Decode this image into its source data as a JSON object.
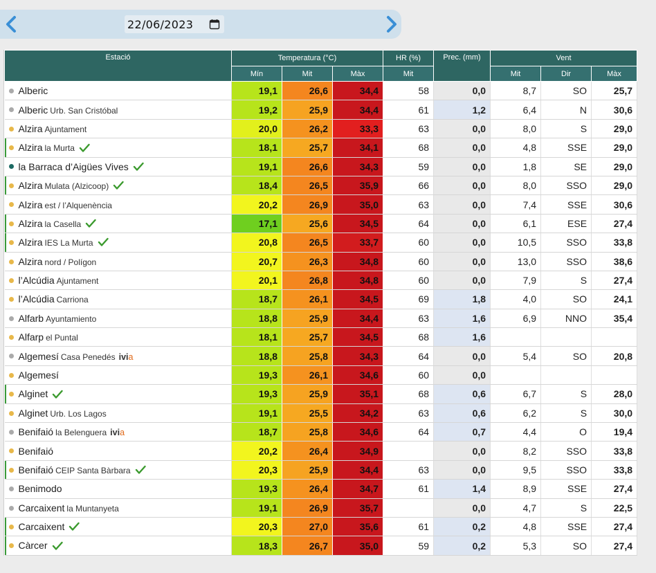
{
  "date": {
    "value": "22/06/2023",
    "prev_icon": "chevron-left-icon",
    "next_icon": "chevron-right-icon",
    "calendar_icon": "calendar-icon"
  },
  "colors": {
    "header_bg": "#2e6662",
    "nav_arrow": "#3a8fd6",
    "check": "#3b9a2e",
    "dot_yellow": "#e8b84a",
    "dot_gray": "#aaaaaa",
    "dot_teal": "#1c6a63"
  },
  "table": {
    "headers": {
      "station": "Estació",
      "temperature": "Temperatura (°C)",
      "humidity": "HR (%)",
      "precip": "Prec. (mm)",
      "wind": "Vent",
      "t_min": "Mín",
      "t_mid": "Mit",
      "t_max": "Màx",
      "hr_mid": "Mit",
      "w_mid": "Mit",
      "w_dir": "Dir",
      "w_max": "Màx"
    },
    "rows": [
      {
        "name": "Alberic",
        "sub": "",
        "dot": "gray",
        "check": false,
        "ivia": false,
        "flag": false,
        "tmin": "19,1",
        "tmid": "26,6",
        "tmax": "34,4",
        "tmin_c": "#b7e41b",
        "tmid_c": "#f4861f",
        "tmax_c": "#c8171d",
        "hr": "58",
        "prec": "0,0",
        "wet": false,
        "wmid": "8,7",
        "wdir": "SO",
        "wmax": "25,7"
      },
      {
        "name": "Alberic",
        "sub": "Urb. San Cristóbal",
        "dot": "gray",
        "check": false,
        "ivia": false,
        "flag": false,
        "tmin": "19,2",
        "tmid": "25,9",
        "tmax": "34,4",
        "tmin_c": "#b7e41b",
        "tmid_c": "#f6a321",
        "tmax_c": "#c8171d",
        "hr": "61",
        "prec": "1,2",
        "wet": true,
        "wmid": "6,4",
        "wdir": "N",
        "wmax": "30,6"
      },
      {
        "name": "Alzira",
        "sub": "Ajuntament",
        "dot": "yellow",
        "check": false,
        "ivia": false,
        "flag": false,
        "tmin": "20,0",
        "tmid": "26,2",
        "tmax": "33,3",
        "tmin_c": "#e2f01c",
        "tmid_c": "#f5921f",
        "tmax_c": "#e21f1f",
        "hr": "63",
        "prec": "0,0",
        "wet": false,
        "wmid": "8,0",
        "wdir": "S",
        "wmax": "29,0"
      },
      {
        "name": "Alzira",
        "sub": "la Murta",
        "dot": "yellow",
        "check": true,
        "ivia": false,
        "flag": true,
        "tmin": "18,1",
        "tmid": "25,7",
        "tmax": "34,1",
        "tmin_c": "#b7e41b",
        "tmid_c": "#f6a821",
        "tmax_c": "#c8171d",
        "hr": "68",
        "prec": "0,0",
        "wet": false,
        "wmid": "4,8",
        "wdir": "SSE",
        "wmax": "29,0"
      },
      {
        "name": "la Barraca d’Aigües Vives",
        "sub": "",
        "dot": "teal",
        "check": true,
        "ivia": false,
        "flag": false,
        "tmin": "19,1",
        "tmid": "26,6",
        "tmax": "34,3",
        "tmin_c": "#b7e41b",
        "tmid_c": "#f4861f",
        "tmax_c": "#c8171d",
        "hr": "59",
        "prec": "0,0",
        "wet": false,
        "wmid": "1,8",
        "wdir": "SE",
        "wmax": "29,0"
      },
      {
        "name": "Alzira",
        "sub": "Mulata (Alzicoop)",
        "dot": "yellow",
        "check": true,
        "ivia": false,
        "flag": true,
        "tmin": "18,4",
        "tmid": "26,5",
        "tmax": "35,9",
        "tmin_c": "#b7e41b",
        "tmid_c": "#f4861f",
        "tmax_c": "#c8171d",
        "hr": "66",
        "prec": "0,0",
        "wet": false,
        "wmid": "8,0",
        "wdir": "SSO",
        "wmax": "29,0"
      },
      {
        "name": "Alzira",
        "sub": "est / l’Alquenència",
        "dot": "yellow",
        "check": false,
        "ivia": false,
        "flag": false,
        "tmin": "20,2",
        "tmid": "26,9",
        "tmax": "35,0",
        "tmin_c": "#f2f51e",
        "tmid_c": "#f4861f",
        "tmax_c": "#c8171d",
        "hr": "63",
        "prec": "0,0",
        "wet": false,
        "wmid": "7,4",
        "wdir": "SSE",
        "wmax": "30,6"
      },
      {
        "name": "Alzira",
        "sub": "la Casella",
        "dot": "yellow",
        "check": true,
        "ivia": false,
        "flag": true,
        "tmin": "17,1",
        "tmid": "25,6",
        "tmax": "34,5",
        "tmin_c": "#6fcf1f",
        "tmid_c": "#f6a821",
        "tmax_c": "#c8171d",
        "hr": "64",
        "prec": "0,0",
        "wet": false,
        "wmid": "6,1",
        "wdir": "ESE",
        "wmax": "27,4"
      },
      {
        "name": "Alzira",
        "sub": "IES La Murta",
        "dot": "yellow",
        "check": true,
        "ivia": false,
        "flag": true,
        "tmin": "20,8",
        "tmid": "26,5",
        "tmax": "33,7",
        "tmin_c": "#f2f51e",
        "tmid_c": "#f4861f",
        "tmax_c": "#d21c1e",
        "hr": "60",
        "prec": "0,0",
        "wet": false,
        "wmid": "10,5",
        "wdir": "SSO",
        "wmax": "33,8"
      },
      {
        "name": "Alzira",
        "sub": "nord / Polígon",
        "dot": "yellow",
        "check": false,
        "ivia": false,
        "flag": false,
        "tmin": "20,7",
        "tmid": "26,3",
        "tmax": "34,8",
        "tmin_c": "#f2f51e",
        "tmid_c": "#f5921f",
        "tmax_c": "#c8171d",
        "hr": "60",
        "prec": "0,0",
        "wet": false,
        "wmid": "13,0",
        "wdir": "SSO",
        "wmax": "38,6"
      },
      {
        "name": "l’Alcúdia",
        "sub": "Ajuntament",
        "dot": "yellow",
        "check": false,
        "ivia": false,
        "flag": false,
        "tmin": "20,1",
        "tmid": "26,8",
        "tmax": "34,8",
        "tmin_c": "#f2f51e",
        "tmid_c": "#f4861f",
        "tmax_c": "#c8171d",
        "hr": "60",
        "prec": "0,0",
        "wet": false,
        "wmid": "7,9",
        "wdir": "S",
        "wmax": "27,4"
      },
      {
        "name": "l’Alcúdia",
        "sub": "Carriona",
        "dot": "yellow",
        "check": false,
        "ivia": false,
        "flag": false,
        "tmin": "18,7",
        "tmid": "26,1",
        "tmax": "34,5",
        "tmin_c": "#b7e41b",
        "tmid_c": "#f5921f",
        "tmax_c": "#c8171d",
        "hr": "69",
        "prec": "1,8",
        "wet": true,
        "wmid": "4,0",
        "wdir": "SO",
        "wmax": "24,1"
      },
      {
        "name": "Alfarb",
        "sub": "Ayuntamiento",
        "dot": "gray",
        "check": false,
        "ivia": false,
        "flag": false,
        "tmin": "18,8",
        "tmid": "25,9",
        "tmax": "34,4",
        "tmin_c": "#b7e41b",
        "tmid_c": "#f6a321",
        "tmax_c": "#c8171d",
        "hr": "63",
        "prec": "1,6",
        "wet": true,
        "wmid": "6,9",
        "wdir": "NNO",
        "wmax": "35,4"
      },
      {
        "name": "Alfarp",
        "sub": "el Puntal",
        "dot": "yellow",
        "check": false,
        "ivia": false,
        "flag": false,
        "tmin": "18,1",
        "tmid": "25,7",
        "tmax": "34,5",
        "tmin_c": "#b7e41b",
        "tmid_c": "#f6a821",
        "tmax_c": "#c8171d",
        "hr": "68",
        "prec": "1,6",
        "wet": true,
        "wmid": "",
        "wdir": "",
        "wmax": ""
      },
      {
        "name": "Algemesí",
        "sub": "Casa Penedés",
        "dot": "gray",
        "check": false,
        "ivia": true,
        "flag": false,
        "tmin": "18,8",
        "tmid": "25,8",
        "tmax": "34,3",
        "tmin_c": "#b7e41b",
        "tmid_c": "#f6a321",
        "tmax_c": "#c8171d",
        "hr": "64",
        "prec": "0,0",
        "wet": false,
        "wmid": "5,4",
        "wdir": "SO",
        "wmax": "20,8"
      },
      {
        "name": "Algemesí",
        "sub": "",
        "dot": "yellow",
        "check": false,
        "ivia": false,
        "flag": false,
        "tmin": "19,3",
        "tmid": "26,1",
        "tmax": "34,6",
        "tmin_c": "#b7e41b",
        "tmid_c": "#f5921f",
        "tmax_c": "#c8171d",
        "hr": "60",
        "prec": "0,0",
        "wet": false,
        "wmid": "",
        "wdir": "",
        "wmax": ""
      },
      {
        "name": "Alginet",
        "sub": "",
        "dot": "yellow",
        "check": true,
        "ivia": false,
        "flag": true,
        "tmin": "19,3",
        "tmid": "25,9",
        "tmax": "35,1",
        "tmin_c": "#b7e41b",
        "tmid_c": "#f6a321",
        "tmax_c": "#c8171d",
        "hr": "68",
        "prec": "0,6",
        "wet": true,
        "wmid": "6,7",
        "wdir": "S",
        "wmax": "28,0"
      },
      {
        "name": "Alginet",
        "sub": "Urb. Los Lagos",
        "dot": "yellow",
        "check": false,
        "ivia": false,
        "flag": false,
        "tmin": "19,1",
        "tmid": "25,5",
        "tmax": "34,2",
        "tmin_c": "#b7e41b",
        "tmid_c": "#f6a821",
        "tmax_c": "#c8171d",
        "hr": "63",
        "prec": "0,6",
        "wet": true,
        "wmid": "6,2",
        "wdir": "S",
        "wmax": "30,0"
      },
      {
        "name": "Benifaió",
        "sub": "la Belenguera",
        "dot": "gray",
        "check": false,
        "ivia": true,
        "flag": false,
        "tmin": "18,7",
        "tmid": "25,8",
        "tmax": "34,6",
        "tmin_c": "#b7e41b",
        "tmid_c": "#f6a321",
        "tmax_c": "#c8171d",
        "hr": "64",
        "prec": "0,7",
        "wet": true,
        "wmid": "4,4",
        "wdir": "O",
        "wmax": "19,4"
      },
      {
        "name": "Benifaió",
        "sub": "",
        "dot": "yellow",
        "check": false,
        "ivia": false,
        "flag": false,
        "tmin": "20,2",
        "tmid": "26,4",
        "tmax": "34,9",
        "tmin_c": "#f2f51e",
        "tmid_c": "#f5921f",
        "tmax_c": "#c8171d",
        "hr": "",
        "prec": "0,0",
        "wet": false,
        "wmid": "8,2",
        "wdir": "SSO",
        "wmax": "33,8"
      },
      {
        "name": "Benifaió",
        "sub": "CEIP Santa Bàrbara",
        "dot": "yellow",
        "check": true,
        "ivia": false,
        "flag": true,
        "tmin": "20,3",
        "tmid": "25,9",
        "tmax": "34,4",
        "tmin_c": "#f2f51e",
        "tmid_c": "#f6a321",
        "tmax_c": "#c8171d",
        "hr": "63",
        "prec": "0,0",
        "wet": false,
        "wmid": "9,5",
        "wdir": "SSO",
        "wmax": "33,8"
      },
      {
        "name": "Benimodo",
        "sub": "",
        "dot": "gray",
        "check": false,
        "ivia": false,
        "flag": false,
        "tmin": "19,3",
        "tmid": "26,4",
        "tmax": "34,7",
        "tmin_c": "#b7e41b",
        "tmid_c": "#f5921f",
        "tmax_c": "#c8171d",
        "hr": "61",
        "prec": "1,4",
        "wet": true,
        "wmid": "8,9",
        "wdir": "SSE",
        "wmax": "27,4"
      },
      {
        "name": "Carcaixent",
        "sub": "la Muntanyeta",
        "dot": "gray",
        "check": false,
        "ivia": false,
        "flag": false,
        "tmin": "19,1",
        "tmid": "26,9",
        "tmax": "35,7",
        "tmin_c": "#b7e41b",
        "tmid_c": "#f4861f",
        "tmax_c": "#c8171d",
        "hr": "",
        "prec": "0,0",
        "wet": false,
        "wmid": "4,7",
        "wdir": "S",
        "wmax": "22,5"
      },
      {
        "name": "Carcaixent",
        "sub": "",
        "dot": "yellow",
        "check": true,
        "ivia": false,
        "flag": true,
        "tmin": "20,3",
        "tmid": "27,0",
        "tmax": "35,6",
        "tmin_c": "#f2f51e",
        "tmid_c": "#f4861f",
        "tmax_c": "#c8171d",
        "hr": "61",
        "prec": "0,2",
        "wet": true,
        "wmid": "4,8",
        "wdir": "SSE",
        "wmax": "27,4"
      },
      {
        "name": "Càrcer",
        "sub": "",
        "dot": "yellow",
        "check": true,
        "ivia": false,
        "flag": true,
        "tmin": "18,3",
        "tmid": "26,7",
        "tmax": "35,0",
        "tmin_c": "#b7e41b",
        "tmid_c": "#f4861f",
        "tmax_c": "#c8171d",
        "hr": "59",
        "prec": "0,2",
        "wet": true,
        "wmid": "5,3",
        "wdir": "SO",
        "wmax": "27,4"
      }
    ]
  }
}
